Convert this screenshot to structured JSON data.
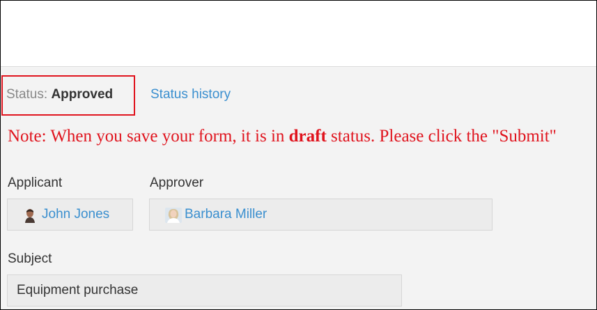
{
  "status": {
    "label": "Status:",
    "value": "Approved",
    "history_link": "Status history",
    "highlight_color": "#e0141e"
  },
  "note": {
    "before": "Note: When you save your form, it is in ",
    "emphasis": "draft",
    "after": " status. Please click the \"Submit\"",
    "color": "#e0141e"
  },
  "applicant": {
    "label": "Applicant",
    "name": "John Jones",
    "avatar_icon": "male-user-avatar-icon"
  },
  "approver": {
    "label": "Approver",
    "name": "Barbara Miller",
    "avatar_icon": "female-user-avatar-icon"
  },
  "subject": {
    "label": "Subject",
    "value": "Equipment purchase"
  },
  "colors": {
    "link": "#3a8fcf",
    "background": "#f3f3f3",
    "field_background": "#ececec"
  }
}
